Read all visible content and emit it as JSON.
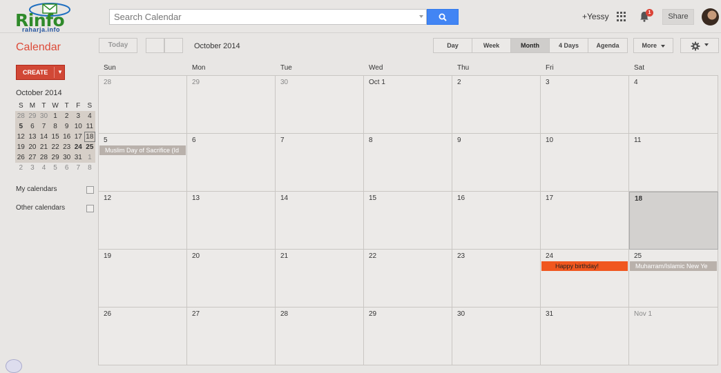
{
  "header": {
    "logo_text": "Rinfo",
    "logo_sub": "raharja.info",
    "search_placeholder": "Search Calendar",
    "user": "+Yessy",
    "notification_count": "1",
    "share_label": "Share"
  },
  "toolbar": {
    "app_title": "Calendar",
    "today_label": "Today",
    "date_range": "October 2014",
    "views": [
      {
        "label": "Day"
      },
      {
        "label": "Week"
      },
      {
        "label": "Month"
      },
      {
        "label": "4 Days"
      },
      {
        "label": "Agenda"
      }
    ],
    "active_view": "Month",
    "more_label": "More"
  },
  "sidebar": {
    "create_label": "CREATE",
    "mini_title": "October 2014",
    "weekday_letters": [
      "S",
      "M",
      "T",
      "W",
      "T",
      "F",
      "S"
    ],
    "weeks": [
      [
        "28",
        "29",
        "30",
        "1",
        "2",
        "3",
        "4"
      ],
      [
        "5",
        "6",
        "7",
        "8",
        "9",
        "10",
        "11"
      ],
      [
        "12",
        "13",
        "14",
        "15",
        "16",
        "17",
        "18"
      ],
      [
        "19",
        "20",
        "21",
        "22",
        "23",
        "24",
        "25"
      ],
      [
        "26",
        "27",
        "28",
        "29",
        "30",
        "31",
        "1"
      ],
      [
        "2",
        "3",
        "4",
        "5",
        "6",
        "7",
        "8"
      ]
    ],
    "my_calendars": "My calendars",
    "other_calendars": "Other calendars"
  },
  "month": {
    "weekdays": [
      "Sun",
      "Mon",
      "Tue",
      "Wed",
      "Thu",
      "Fri",
      "Sat"
    ],
    "weeks": [
      [
        "28",
        "29",
        "30",
        "Oct 1",
        "2",
        "3",
        "4"
      ],
      [
        "5",
        "6",
        "7",
        "8",
        "9",
        "10",
        "11"
      ],
      [
        "12",
        "13",
        "14",
        "15",
        "16",
        "17",
        "18"
      ],
      [
        "19",
        "20",
        "21",
        "22",
        "23",
        "24",
        "25"
      ],
      [
        "26",
        "27",
        "28",
        "29",
        "30",
        "31",
        "Nov 1"
      ]
    ],
    "today": "18",
    "events": [
      {
        "title": "Muslim Day of Sacrifice (Id",
        "date": "5",
        "color": "#b9b1ab"
      },
      {
        "title": "Happy birthday!",
        "date": "24",
        "color": "#f0571f"
      },
      {
        "title": "Muharram/Islamic New Ye",
        "date": "25",
        "color": "#b9b1ab"
      }
    ]
  }
}
